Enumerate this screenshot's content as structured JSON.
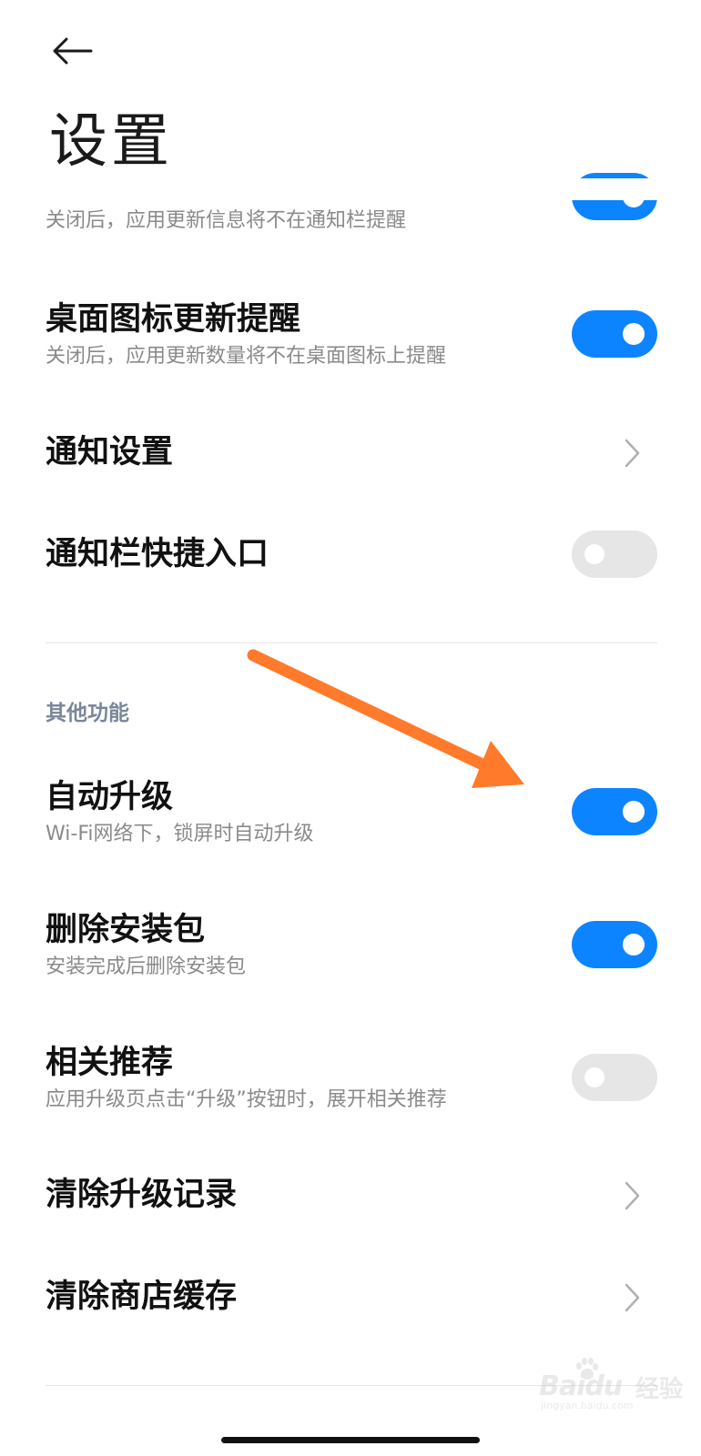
{
  "header": {
    "back_icon": "arrow-left-icon",
    "title": "设置"
  },
  "settings": {
    "partial_notify": {
      "subtitle": "关闭后，应用更新信息将不在通知栏提醒",
      "enabled": true
    },
    "desktop_badge": {
      "title": "桌面图标更新提醒",
      "subtitle": "关闭后，应用更新数量将不在桌面图标上提醒",
      "enabled": true
    },
    "notification_settings": {
      "title": "通知设置",
      "icon": "chevron-right-icon"
    },
    "notification_shortcut": {
      "title": "通知栏快捷入口",
      "enabled": false
    }
  },
  "other_section": {
    "header": "其他功能",
    "auto_upgrade": {
      "title": "自动升级",
      "subtitle": "Wi-Fi网络下，锁屏时自动升级",
      "enabled": true
    },
    "delete_package": {
      "title": "删除安装包",
      "subtitle": "安装完成后删除安装包",
      "enabled": true
    },
    "recommendations": {
      "title": "相关推荐",
      "subtitle": "应用升级页点击“升级”按钮时，展开相关推荐",
      "enabled": false
    },
    "clear_records": {
      "title": "清除升级记录",
      "icon": "chevron-right-icon"
    },
    "clear_cache": {
      "title": "清除商店缓存",
      "icon": "chevron-right-icon"
    }
  },
  "watermark": {
    "brand": "Baidu",
    "label": "经验",
    "url": "jingyan.baidu.com"
  },
  "colors": {
    "accent": "#0d84ff",
    "toggle_off": "#e6e6e6",
    "annotation_arrow": "#ff7a2a",
    "section_header": "#7a869a"
  }
}
